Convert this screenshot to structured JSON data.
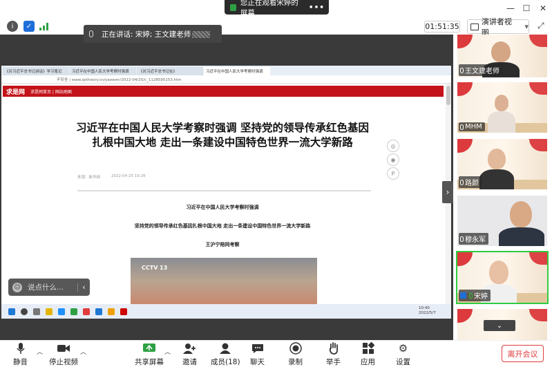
{
  "share_banner": {
    "text": "您正在观看宋婷的屏幕",
    "menu": "•••"
  },
  "window_controls": {
    "minimize": "—",
    "maximize": "☐",
    "close": "✕"
  },
  "toolbar": {
    "timer": "01:51:35",
    "view_label": "演讲者视图",
    "view_caret": "▾"
  },
  "talking": {
    "prefix": "正在讲话:",
    "names": "宋婷; 王文建老师"
  },
  "browser": {
    "tabs": [
      "《对习近平总书记讲话》学习笔记",
      "习近平在中国人民大学考察时强调",
      "《对习近平总书记在》",
      "习近平在中国人民大学考察时强调"
    ],
    "address": "不安全 | www.qstheory.cn/yaowen/2022-04/25/c_1128595153.htm",
    "site_logo": "求是网",
    "site_nav": "求是网首页 | 网站地图",
    "headline": "习近平在中国人民大学考察时强调 坚持党的领导传承红色基因扎根中国大地 走出一条建设中国特色世界一流大学新路",
    "meta_source": "来源：新华网",
    "meta_time": "2022-04-25 19:26",
    "sub1": "习近平在中国人民大学考察时强调",
    "sub2": "坚持党的领导传承红色基因扎根中国大地 走出一条建设中国特色世界一流大学新路",
    "sub3": "王沪宁陪同考察",
    "photo_logo": "CCTV 13",
    "tb_clock_time": "10:40",
    "tb_clock_date": "2022/5/7"
  },
  "chat": {
    "placeholder": "说点什么..."
  },
  "participants": [
    {
      "name": "王文建老师"
    },
    {
      "name": "MHM"
    },
    {
      "name": "路颜"
    },
    {
      "name": "穆永军"
    },
    {
      "name": "宋婷"
    }
  ],
  "bottom_toolbar": {
    "mute": "静音",
    "stop_video": "停止视频",
    "share": "共享屏幕",
    "invite": "邀请",
    "members": "成员(18)",
    "chat": "聊天",
    "record": "录制",
    "raise_hand": "举手",
    "apps": "应用",
    "settings": "设置",
    "leave": "离开会议"
  },
  "colors": {
    "accent_green": "#2ea043",
    "leave_red": "#e03c3c",
    "site_red": "#c4131a"
  }
}
